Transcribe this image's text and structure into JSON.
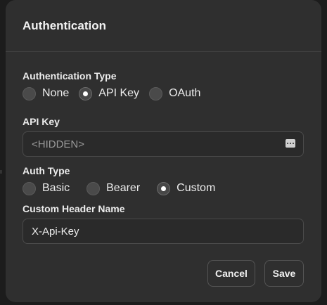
{
  "dialog": {
    "title": "Authentication",
    "auth_type": {
      "label": "Authentication Type",
      "options": [
        "None",
        "API Key",
        "OAuth"
      ],
      "selected": "API Key"
    },
    "api_key": {
      "label": "API Key",
      "placeholder": "<HIDDEN>",
      "icon": "more-icon"
    },
    "header_auth_type": {
      "label": "Auth Type",
      "options": [
        "Basic",
        "Bearer",
        "Custom"
      ],
      "selected": "Custom"
    },
    "custom_header": {
      "label": "Custom Header Name",
      "value": "X-Api-Key"
    },
    "buttons": {
      "cancel": "Cancel",
      "save": "Save"
    }
  },
  "colors": {
    "backdrop": "#1c1c1c",
    "dialog_bg": "#2f2f2f",
    "border": "#4a4a4a",
    "text": "#ececec",
    "placeholder": "#9a9a9a"
  }
}
